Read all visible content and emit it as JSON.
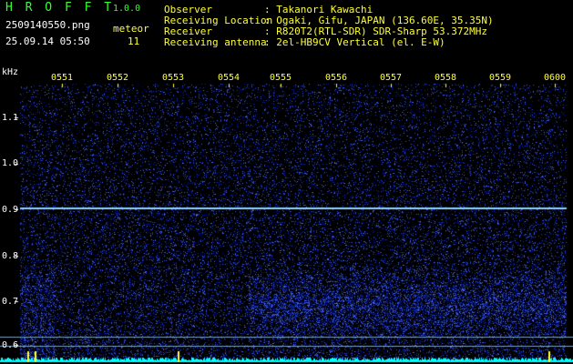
{
  "header": {
    "app_title": "H R O F F T",
    "version": "1.0.0",
    "filename": "2509140550.png",
    "datetime": "25.09.14 05:50",
    "meteor_label": "meteor",
    "meteor_count": "11"
  },
  "info": {
    "observer_label": "Observer",
    "observer_value": ": Takanori Kawachi",
    "location_label": "Receiving Location",
    "location_value": ": Ogaki, Gifu, JAPAN (136.60E, 35.35N)",
    "receiver_label": "Receiver",
    "receiver_value": ": R820T2(RTL-SDR) SDR-Sharp 53.372MHz",
    "antenna_label": "Receiving antenna",
    "antenna_value": ": 2el-HB9CV Vertical (el. E-W)"
  },
  "axis": {
    "unit": "kHz",
    "time_ticks": [
      "0551",
      "0552",
      "0553",
      "0554",
      "0555",
      "0556",
      "0557",
      "0558",
      "0559",
      "0600"
    ],
    "freq_ticks": [
      "1.1",
      "1.0",
      "0.9",
      "0.8",
      "0.7",
      "0.6"
    ]
  },
  "colors": {
    "background": "#000000",
    "label_yellow": "#ffff33",
    "title_green": "#33ff33",
    "carrier_line": "#8fd0ff",
    "noise_blue": "#1a3aff",
    "baseline_cyan": "#00ffff"
  }
}
